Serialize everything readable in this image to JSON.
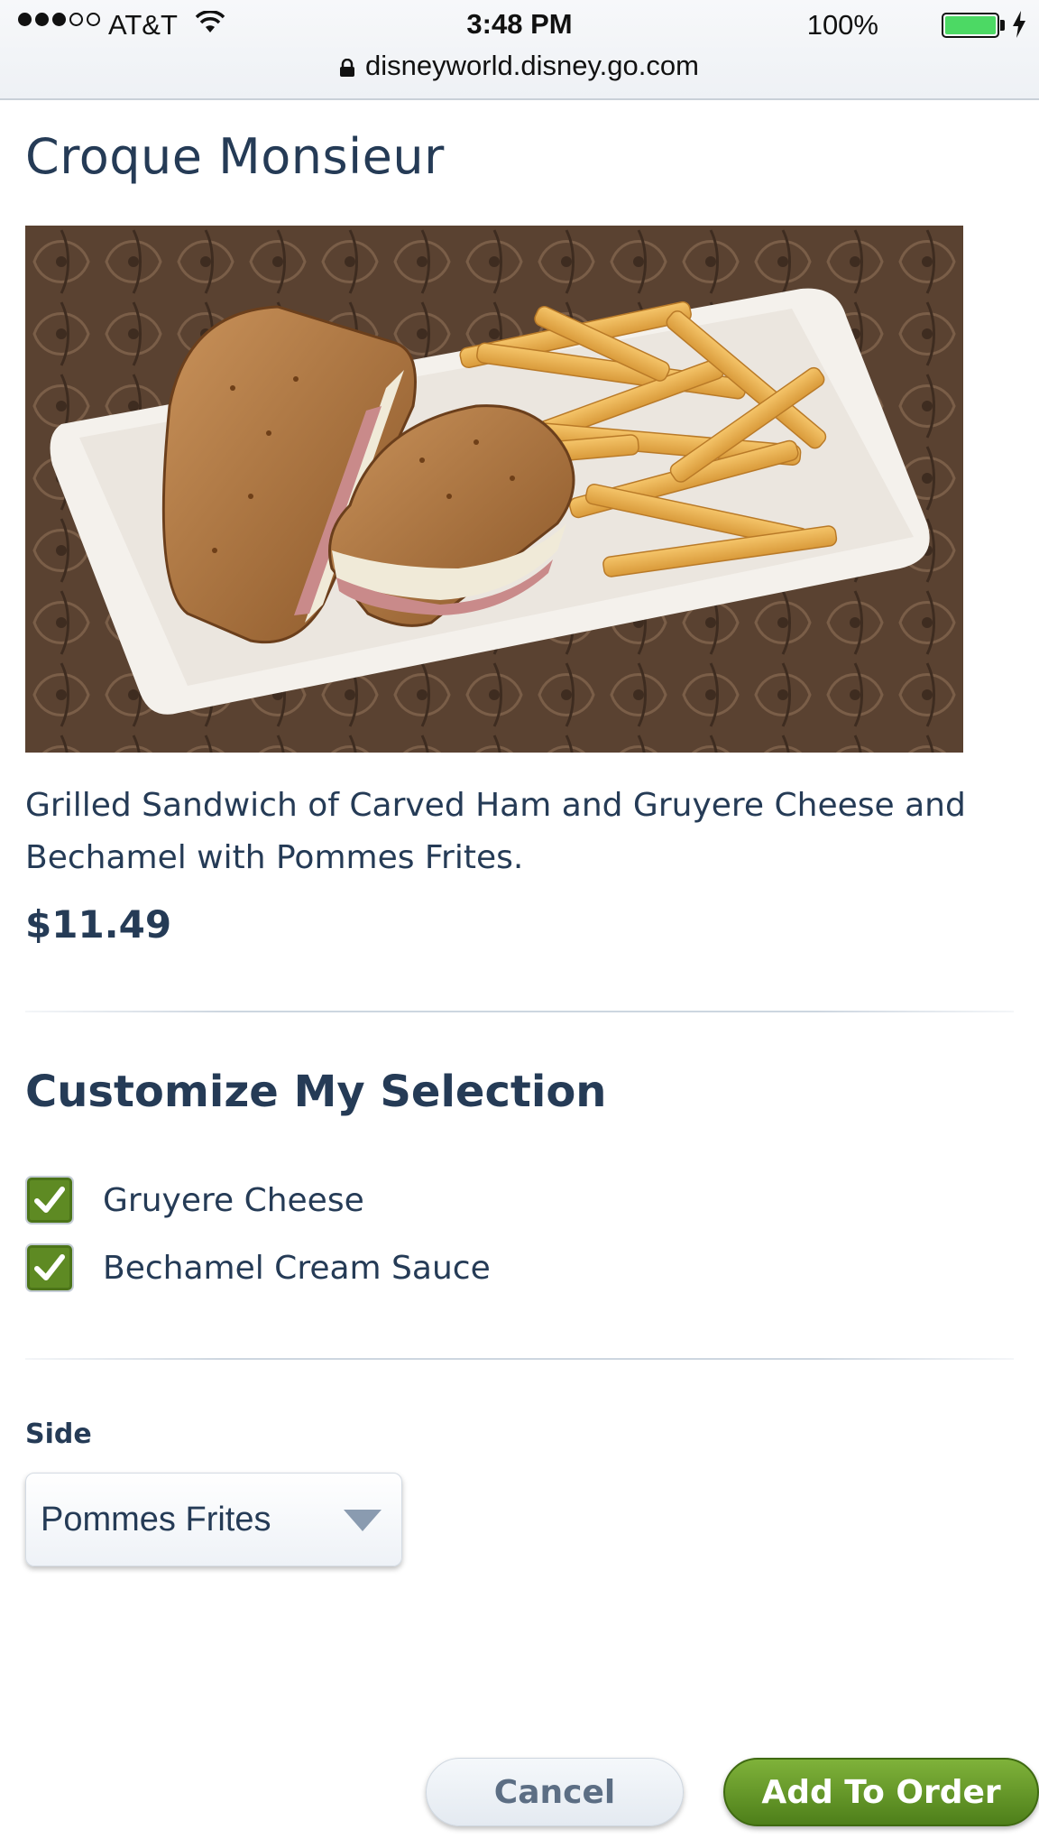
{
  "status_bar": {
    "carrier": "AT&T",
    "signal_bars": 3,
    "time": "3:48 PM",
    "battery_percent": "100%"
  },
  "url_bar": {
    "url": "disneyworld.disney.go.com"
  },
  "item": {
    "title": "Croque Monsieur",
    "image_icon": "food-photo-croque-monsieur",
    "description": "Grilled Sandwich of Carved Ham and Gruyere Cheese and Bechamel with Pommes Frites.",
    "price": "$11.49"
  },
  "customize": {
    "heading": "Customize My Selection",
    "options": [
      {
        "label": "Gruyere Cheese",
        "checked": true
      },
      {
        "label": "Bechamel Cream Sauce",
        "checked": true
      }
    ]
  },
  "side": {
    "label": "Side",
    "selected": "Pommes Frites"
  },
  "actions": {
    "cancel_label": "Cancel",
    "add_label": "Add To Order"
  },
  "colors": {
    "text": "#253b56",
    "accent_green": "#5e8a23",
    "battery": "#4cd964"
  }
}
